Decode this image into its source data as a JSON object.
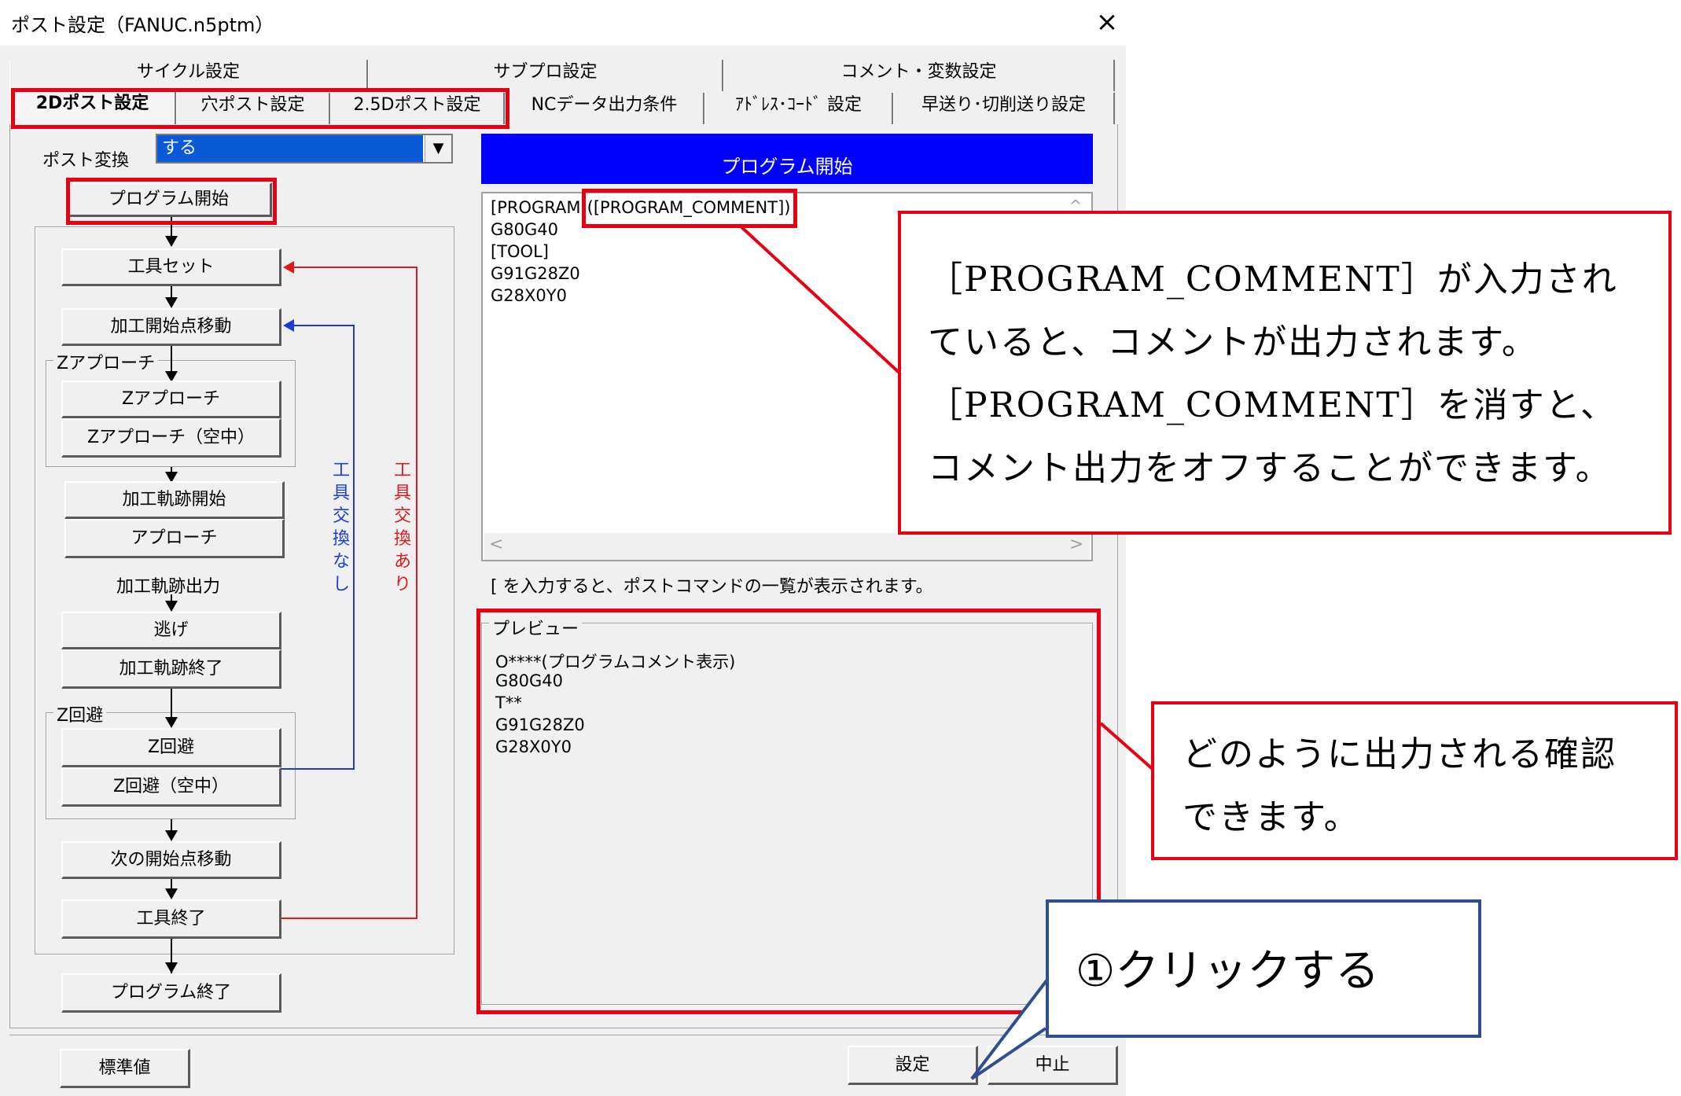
{
  "window": {
    "title": "ポスト設定（FANUC.n5ptm）",
    "close": "×"
  },
  "tabs_row1": [
    "サイクル設定",
    "サブプロ設定",
    "コメント・変数設定"
  ],
  "tabs_row2": [
    "2Dポスト設定",
    "穴ポスト設定",
    "2.5Dポスト設定",
    "NCデータ出力条件",
    "ｱﾄﾞﾚｽ･ｺｰﾄﾞ 設定",
    "早送り･切削送り設定"
  ],
  "post_conversion": {
    "label": "ポスト変換",
    "value": "する",
    "arrow": "▼"
  },
  "flow": {
    "program_start": "プログラム開始",
    "tool_set": "工具セット",
    "move_start_point": "加工開始点移動",
    "z_approach_group": "Zアプローチ",
    "z_approach": "Zアプローチ",
    "z_approach_air": "Zアプローチ（空中）",
    "path_start": "加工軌跡開始",
    "approach": "アプローチ",
    "path_output": "加工軌跡出力",
    "escape": "逃げ",
    "path_end": "加工軌跡終了",
    "z_retract_group": "Z回避",
    "z_retract": "Z回避",
    "z_retract_air": "Z回避（空中）",
    "next_start_move": "次の開始点移動",
    "tool_end": "工具終了",
    "program_end": "プログラム終了",
    "loop_no_change": "工具交換なし",
    "loop_with_change": "工具交換あり"
  },
  "colors": {
    "loop_no_change": "#1e3cd8",
    "loop_with_change": "#e0191f",
    "annotation_red": "#e60012",
    "callout_blue": "#2f4f8f",
    "header_blue": "#0000ff"
  },
  "editor": {
    "header": "プログラム開始",
    "lines": [
      "[PROGRAM]([PROGRAM_COMMENT])",
      "G80G40",
      "[TOOL]",
      "G91G28Z0",
      "G28X0Y0"
    ],
    "scroll_left": "<",
    "scroll_right": ">",
    "scroll_up": "^"
  },
  "hint": "[ を入力すると、ポストコマンドの一覧が表示されます。",
  "preview": {
    "legend": "プレビュー",
    "lines": [
      "O****(プログラムコメント表示)",
      "G80G40",
      "T**",
      "G91G28Z0",
      "G28X0Y0"
    ]
  },
  "buttons": {
    "default": "標準値",
    "set": "設定",
    "cancel": "中止"
  },
  "callouts": {
    "comment_info": [
      "［PROGRAM_COMMENT］が入力され",
      "ていると、コメントが出力されます。",
      "［PROGRAM_COMMENT］を消すと、",
      "コメント出力をオフすることができます。"
    ],
    "preview_info": [
      "どのように出力される確認",
      "できます。"
    ],
    "click_info": "①クリックする"
  }
}
